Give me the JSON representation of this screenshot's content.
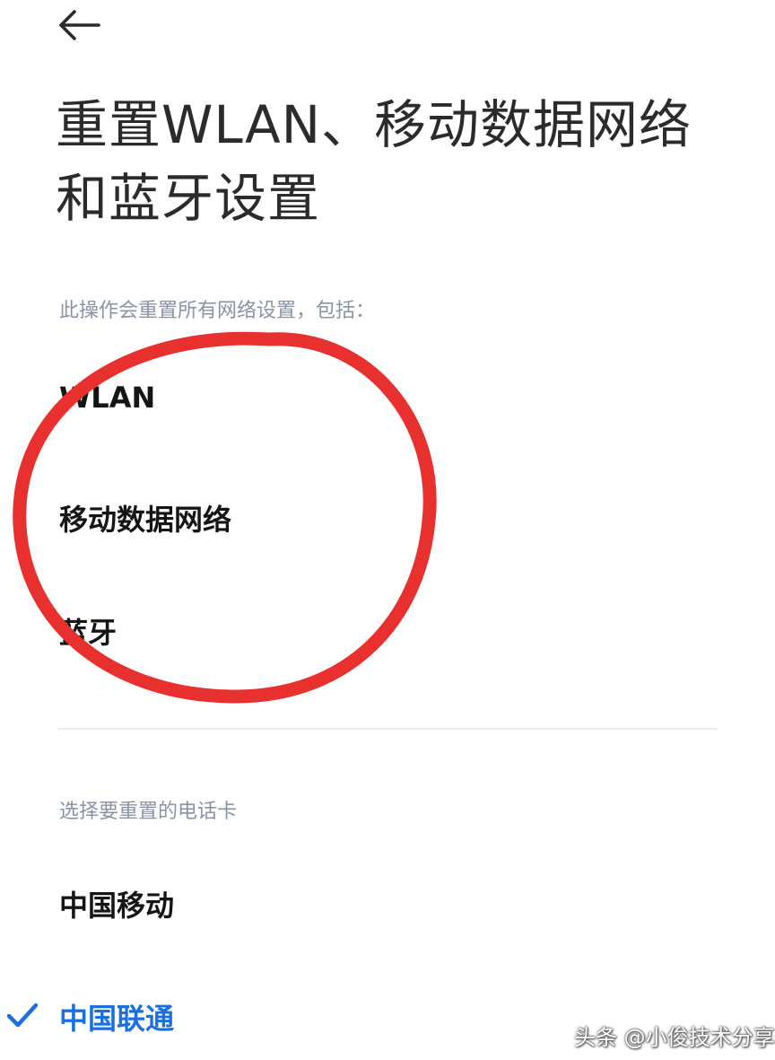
{
  "header": {
    "back_icon": "arrow-left-icon"
  },
  "page": {
    "title_line1": "重置WLAN、移动数据网络",
    "title_line2": "和蓝牙设置"
  },
  "reset_section": {
    "description": "此操作会重置所有网络设置，包括：",
    "items": [
      {
        "label": "WLAN"
      },
      {
        "label": "移动数据网络"
      },
      {
        "label": "蓝牙"
      }
    ]
  },
  "sim_section": {
    "label": "选择要重置的电话卡",
    "options": [
      {
        "label": "中国移动",
        "selected": false
      },
      {
        "label": "中国联通",
        "selected": true
      }
    ]
  },
  "annotation": {
    "type": "hand-drawn-circle",
    "color": "#e8312f"
  },
  "watermark": {
    "text": "头条 @小俊技术分享"
  },
  "colors": {
    "accent": "#1b6fe0",
    "muted_label": "#8a93a6",
    "annotation": "#e8312f"
  }
}
